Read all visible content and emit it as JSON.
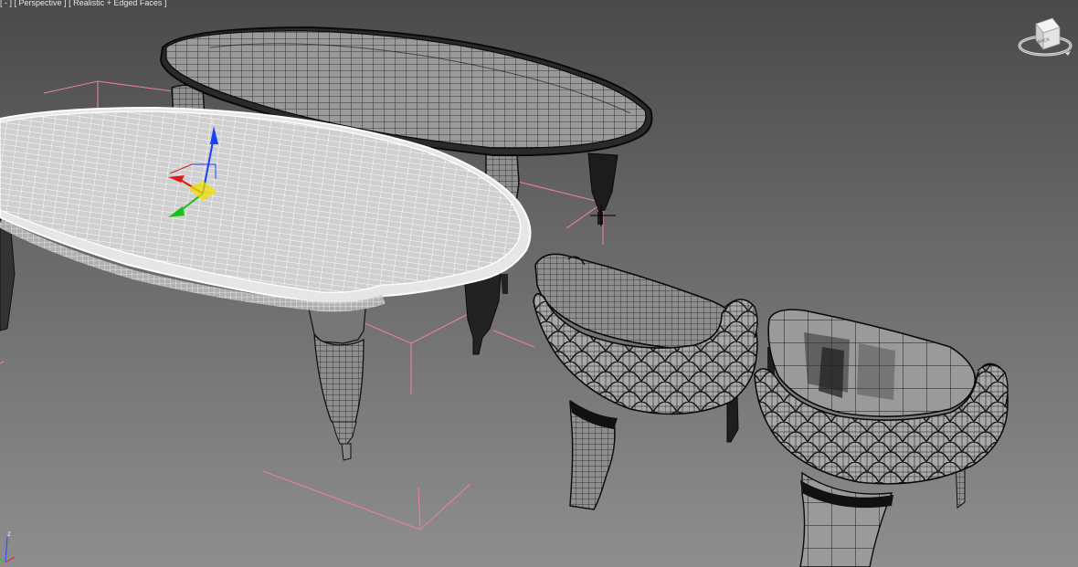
{
  "viewport": {
    "menu_general": "[ - ]",
    "menu_view": "[ Perspective ]",
    "menu_shading": "[ Realistic + Edged Faces ]"
  },
  "viewcube": {
    "face_label": "BACK",
    "icon": "viewcube-icon"
  },
  "gizmo": {
    "axis_z_label": "z",
    "colors": {
      "x": "#e01818",
      "y": "#18c018",
      "z": "#1840ff",
      "plane": "#f0e000"
    }
  },
  "world_axis": {
    "label": "z"
  },
  "colors": {
    "bounding_box": "#e8809a",
    "selected_wire": "#ffffff",
    "wire": "#1a1a1a"
  }
}
